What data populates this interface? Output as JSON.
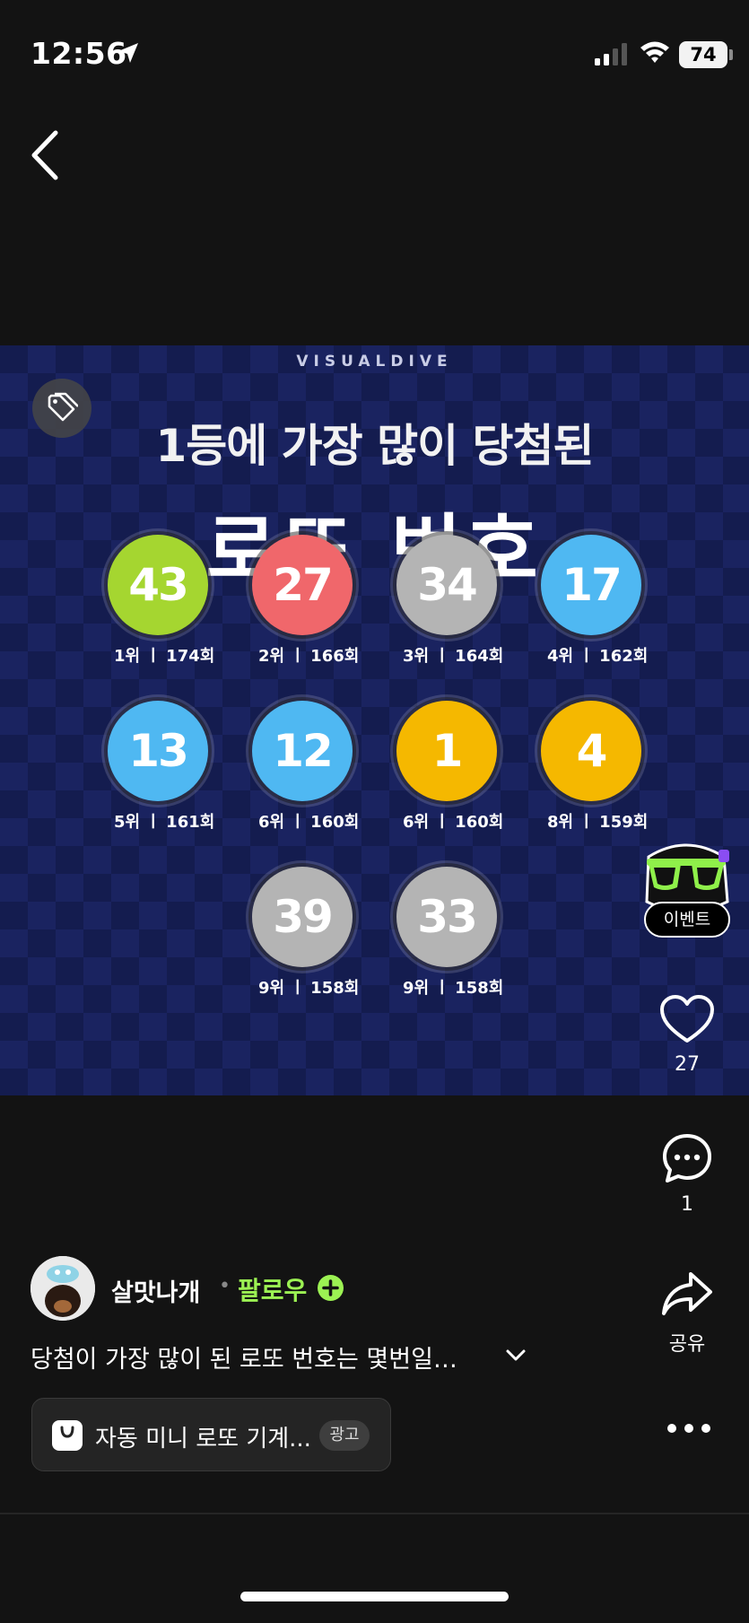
{
  "status_bar": {
    "time": "12:56",
    "battery": "74",
    "icons": [
      "location-arrow-icon",
      "cellular-signal-icon",
      "wifi-icon",
      "battery-icon"
    ]
  },
  "nav": {
    "back_icon": "chevron-left-icon"
  },
  "post": {
    "brand": "VISUALDIVE",
    "headline": "1등에 가장 많이 당첨된",
    "title": "로또 번호",
    "tag_icon": "tag-icon",
    "balls": [
      {
        "number": "43",
        "rank": "1위 ㅣ 174회",
        "color": "#a5d630"
      },
      {
        "number": "27",
        "rank": "2위 ㅣ 166회",
        "color": "#f0676b"
      },
      {
        "number": "34",
        "rank": "3위 ㅣ 164회",
        "color": "#b4b4b4"
      },
      {
        "number": "17",
        "rank": "4위 ㅣ 162회",
        "color": "#4fb8f2"
      },
      {
        "number": "13",
        "rank": "5위 ㅣ 161회",
        "color": "#4fb8f2"
      },
      {
        "number": "12",
        "rank": "6위 ㅣ 160회",
        "color": "#4fb8f2"
      },
      {
        "number": "1",
        "rank": "6위 ㅣ 160회",
        "color": "#f5b800"
      },
      {
        "number": "4",
        "rank": "8위 ㅣ 159회",
        "color": "#f5b800"
      },
      {
        "number": "39",
        "rank": "9위 ㅣ 158회",
        "color": "#b4b4b4"
      },
      {
        "number": "33",
        "rank": "9위 ㅣ 158회",
        "color": "#b4b4b4"
      }
    ]
  },
  "actions": {
    "event_label": "이벤트",
    "like_count": "27",
    "comment_count": "1",
    "share_label": "공유"
  },
  "author": {
    "name": "살맛나개",
    "separator": "•",
    "follow_label": "팔로우"
  },
  "caption": "당첨이 가장 많이 된 로또 번호는 몇번일…",
  "ad": {
    "text": "자동 미니 로또 기계...",
    "label": "광고"
  },
  "colors": {
    "follow_accent": "#9cf253",
    "background": "#131313"
  }
}
